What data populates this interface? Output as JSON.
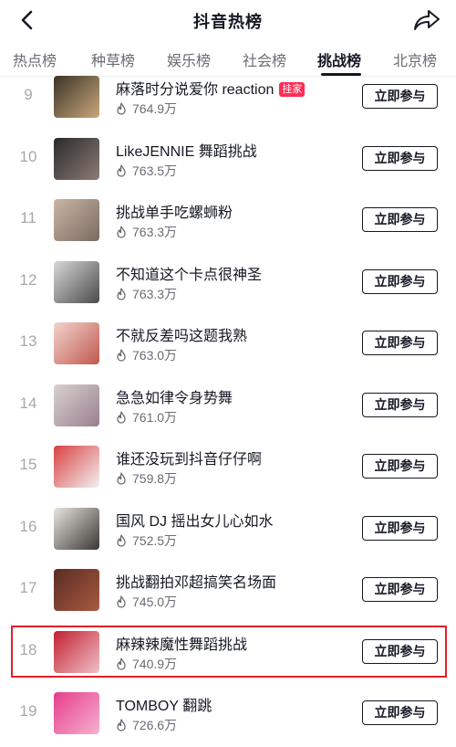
{
  "header": {
    "title": "抖音热榜"
  },
  "tabs": [
    {
      "label": "热点榜",
      "active": false
    },
    {
      "label": "种草榜",
      "active": false
    },
    {
      "label": "娱乐榜",
      "active": false
    },
    {
      "label": "社会榜",
      "active": false
    },
    {
      "label": "挑战榜",
      "active": true
    },
    {
      "label": "北京榜",
      "active": false
    }
  ],
  "button_label": "立即参与",
  "rows": [
    {
      "rank": "9",
      "name": "麻落时分说爱你 reaction",
      "badge": "挂家",
      "heat": "764.9万",
      "thumb_colors": [
        "#3a3328",
        "#c9a87a"
      ]
    },
    {
      "rank": "10",
      "name": "LikeJENNIE 舞蹈挑战",
      "badge": "",
      "heat": "763.5万",
      "thumb_colors": [
        "#2b2b2b",
        "#8c7b74"
      ]
    },
    {
      "rank": "11",
      "name": "挑战单手吃螺蛳粉",
      "badge": "",
      "heat": "763.3万",
      "thumb_colors": [
        "#c9b6a6",
        "#7a6a60"
      ]
    },
    {
      "rank": "12",
      "name": "不知道这个卡点很神圣",
      "badge": "",
      "heat": "763.3万",
      "thumb_colors": [
        "#d8d8d8",
        "#4a4a4a"
      ]
    },
    {
      "rank": "13",
      "name": "不就反差吗这题我熟",
      "badge": "",
      "heat": "763.0万",
      "thumb_colors": [
        "#f2d4cc",
        "#c0584f"
      ]
    },
    {
      "rank": "14",
      "name": "急急如律令身势舞",
      "badge": "",
      "heat": "761.0万",
      "thumb_colors": [
        "#d7d2cf",
        "#9a7f8f"
      ]
    },
    {
      "rank": "15",
      "name": "谁还没玩到抖音仔仔啊",
      "badge": "",
      "heat": "759.8万",
      "thumb_colors": [
        "#d94040",
        "#f2f2f2"
      ]
    },
    {
      "rank": "16",
      "name": "国风 DJ 摇出女儿心如水",
      "badge": "",
      "heat": "752.5万",
      "thumb_colors": [
        "#e8e4de",
        "#3b3733"
      ]
    },
    {
      "rank": "17",
      "name": "挑战翻拍邓超搞笑名场面",
      "badge": "",
      "heat": "745.0万",
      "thumb_colors": [
        "#5a2c24",
        "#a85a40"
      ]
    },
    {
      "rank": "18",
      "name": "麻辣辣魔性舞蹈挑战",
      "badge": "",
      "heat": "740.9万",
      "thumb_colors": [
        "#c22030",
        "#f0c0c8"
      ]
    },
    {
      "rank": "19",
      "name": "TOMBOY 翻跳",
      "badge": "",
      "heat": "726.6万",
      "thumb_colors": [
        "#e63e8a",
        "#f7b0d0"
      ]
    }
  ],
  "colors": {
    "accent": "#fe2c55",
    "highlight_border": "#e0202a",
    "text_primary": "#161823",
    "text_secondary": "#6b6c73"
  }
}
